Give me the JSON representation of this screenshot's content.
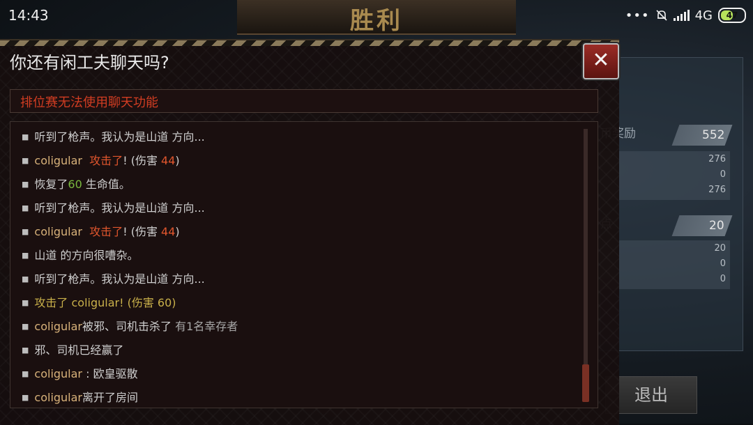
{
  "status_bar": {
    "time": "14:43",
    "dots": "•••",
    "network": "4G",
    "network_sub": "ıl",
    "battery": "47",
    "battery_level": 0.47
  },
  "background": {
    "banner_title": "胜利",
    "right_panel": {
      "section1_label": "币奖励",
      "section1_value": "552",
      "section1_rows": [
        "276",
        "0",
        "276"
      ],
      "section2_label": "点",
      "section2_value": "20",
      "section2_rows": [
        "20",
        "0",
        "0"
      ]
    },
    "exit_label": "退出"
  },
  "dialog": {
    "title": "你还有闲工夫聊天吗?",
    "close_symbol": "✕",
    "notice": "排位赛无法使用聊天功能",
    "messages": [
      {
        "text": "听到了枪声。我认为是山道 方向..."
      },
      {
        "name": "coligular",
        "action": "攻击了",
        "suffix": "! (伤害 ",
        "dmg": "44",
        "end": ")"
      },
      {
        "pre": "恢复了",
        "heal": "60",
        "post": " 生命值。"
      },
      {
        "text": "听到了枪声。我认为是山道 方向..."
      },
      {
        "name": "coligular",
        "action": "攻击了",
        "suffix": "! (伤害 ",
        "dmg": "44",
        "end": ")"
      },
      {
        "text": "山道 的方向很嘈杂。"
      },
      {
        "text": "听到了枪声。我认为是山道 方向..."
      },
      {
        "gold": "攻击了 coligular! (伤害 60)"
      },
      {
        "name": "coligular",
        "mid": "被邪、司机击杀了",
        "post": " 有1名幸存者"
      },
      {
        "text": "邪、司机已经赢了"
      },
      {
        "name": "coligular",
        "post": " : 欧皇驱散"
      },
      {
        "name": "coligular",
        "post": "离开了房间"
      }
    ]
  }
}
